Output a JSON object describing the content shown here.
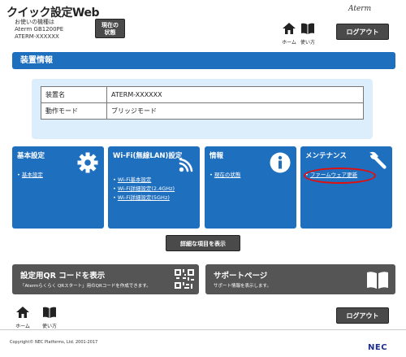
{
  "header": {
    "app_title": "クイック設定Web",
    "model_caption": "お使いの機種は",
    "model_name": "Aterm GB1200PE",
    "device_id": "ATERM-XXXXXX",
    "status_button": [
      "現在の",
      "状態"
    ],
    "brand": "Aterm",
    "home_label": "ホーム",
    "help_label": "使い方",
    "logout_label": "ログアウト"
  },
  "section": {
    "title": "装置情報"
  },
  "device_info": {
    "rows": [
      {
        "key": "装置名",
        "value": "ATERM-XXXXXX"
      },
      {
        "key": "動作モード",
        "value": "ブリッジモード"
      }
    ]
  },
  "tiles": [
    {
      "title": "基本設定",
      "icon": "gear-icon",
      "links": [
        "基本設定"
      ]
    },
    {
      "title": "Wi-Fi(無線LAN)設定",
      "icon": "wifi-icon",
      "links": [
        "Wi-Fi基本設定",
        "Wi-Fi詳細設定(2.4GHz)",
        "Wi-Fi詳細設定(5GHz)"
      ]
    },
    {
      "title": "情報",
      "icon": "info-icon",
      "links": [
        "現在の状態"
      ]
    },
    {
      "title": "メンテナンス",
      "icon": "wrench-icon",
      "links": [
        "ファームウェア更新"
      ]
    }
  ],
  "detail_button": "詳細な項目を表示",
  "qr_panel": {
    "title": "設定用QR コードを表示",
    "description": "「Atermらくらく QRスタート」用のQRコードを作成できます。",
    "icon": "qr-code-icon"
  },
  "support_panel": {
    "title": "サポートページ",
    "description": "サポート情報を表示します。",
    "icon": "book-icon"
  },
  "footer": {
    "home_label": "ホーム",
    "help_label": "使い方",
    "logout_label": "ログアウト",
    "copyright": "Copyright© NEC Platforms, Ltd. 2001-2017",
    "nec_logo": "NEC"
  },
  "colors": {
    "primary_blue": "#1f6fbf",
    "light_blue_panel": "#dceefb",
    "dark_button": "#4a4a4a",
    "highlight_red": "#e01010"
  }
}
